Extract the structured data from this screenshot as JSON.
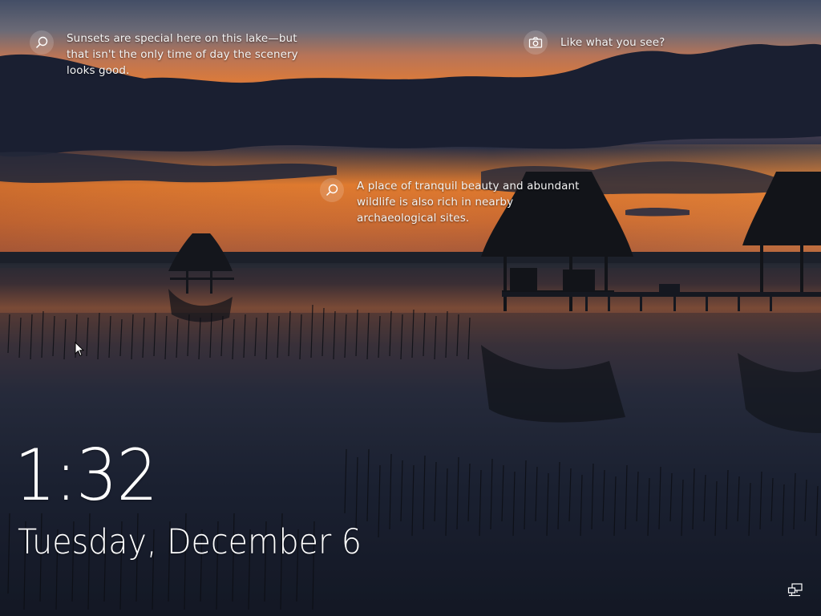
{
  "lock_screen": {
    "clock": {
      "time": "1:32",
      "date": "Tuesday, December 6"
    },
    "spotlight": {
      "hotspot_1": {
        "icon": "search-icon",
        "lines": [
          "Sunsets are special here on this lake—but",
          "that isn't the only time of day the scenery",
          "looks good."
        ]
      },
      "hotspot_2": {
        "icon": "search-icon",
        "lines": [
          "A place of tranquil beauty and abundant",
          "wildlife is also rich in nearby",
          "archaeological sites."
        ]
      },
      "feedback": {
        "icon": "camera-icon",
        "label": "Like what you see?"
      }
    },
    "status_icons": [
      "network-icon"
    ]
  },
  "colors": {
    "sky_top": "#3c4660",
    "sunset_orange": "#e0792c",
    "cloud_dark": "#161b2c",
    "water": "#1a2030",
    "text": "#ffffff"
  }
}
